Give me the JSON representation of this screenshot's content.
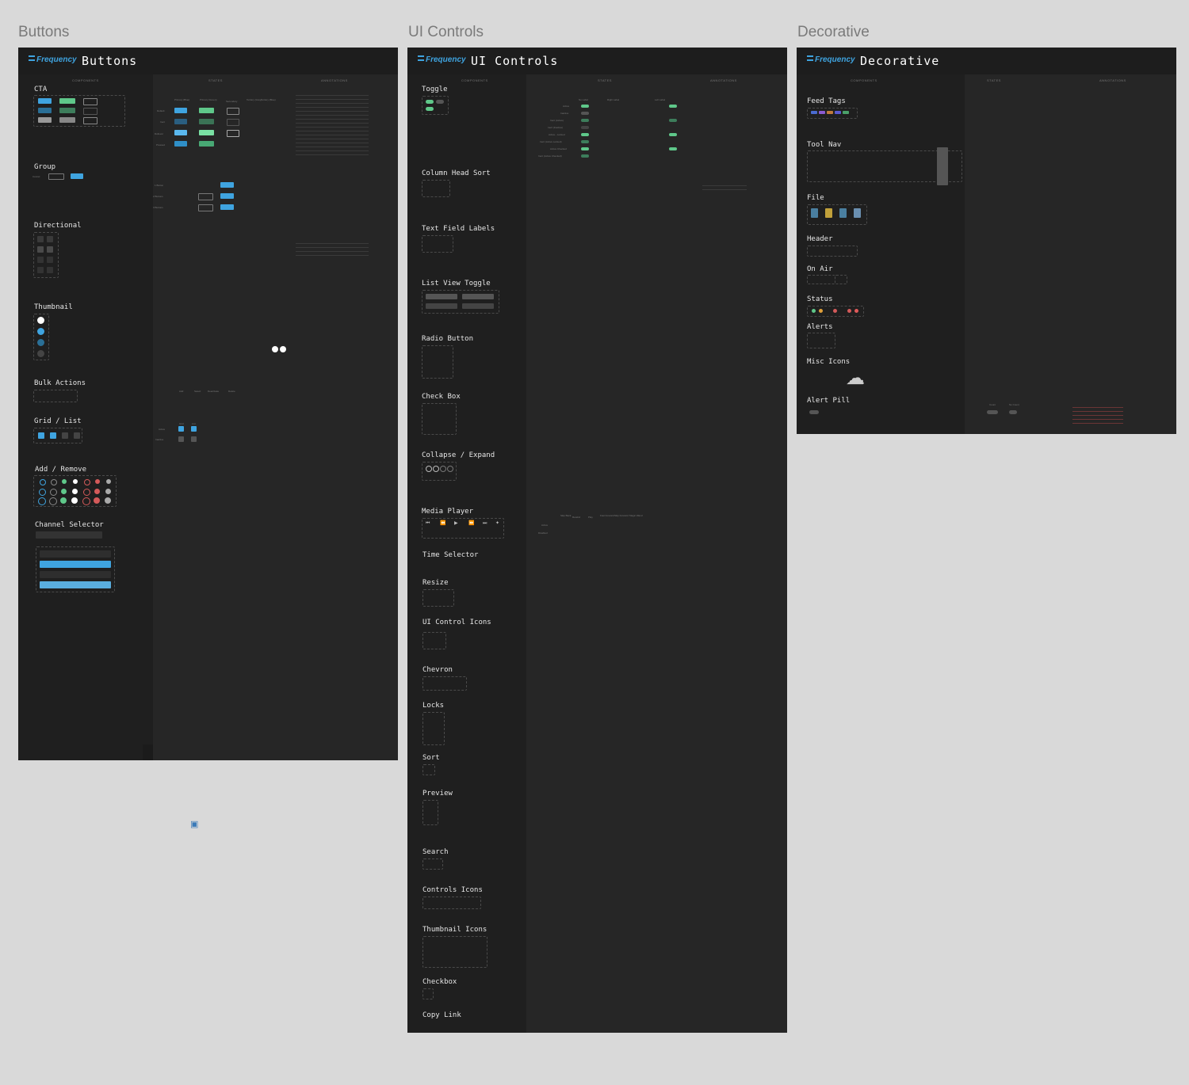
{
  "frames": [
    {
      "label": "Buttons",
      "title": "Buttons",
      "logo": "Frequency",
      "columns": [
        "COMPONENTS",
        "STATES",
        "ANNOTATIONS"
      ],
      "sections": [
        "CTA",
        "Group",
        "Directional",
        "Thumbnail",
        "Bulk Actions",
        "Grid / List",
        "Add / Remove",
        "Channel Selector"
      ],
      "states": [
        "Default",
        "Inert",
        "Rollover",
        "Pressed"
      ],
      "cta_columns": [
        "Primary (Blue)",
        "Primary (Green)",
        "Secondary",
        "Tertiary (Grey)",
        "Tertiary (Blue)"
      ],
      "group_rows": [
        "1 Button",
        "2 Buttons",
        "3 Buttons"
      ],
      "group_buttons": [
        "Cancel",
        "Discard",
        "Save"
      ],
      "bulk_columns": [
        "Add",
        "Select",
        "Deactivate",
        "Delete"
      ],
      "grid_columns": [
        "Grid",
        "List"
      ],
      "grid_states": [
        "Active",
        "Inactive"
      ]
    },
    {
      "label": "UI Controls",
      "title": "UI Controls",
      "logo": "Frequency",
      "columns": [
        "COMPONENTS",
        "STATES",
        "ANNOTATIONS"
      ],
      "sections": [
        "Toggle",
        "Column Head Sort",
        "Text Field Labels",
        "List View Toggle",
        "Radio Button",
        "Check Box",
        "Collapse / Expand",
        "Media Player",
        "Time Selector",
        "Resize",
        "UI Control Icons",
        "Chevron",
        "Locks",
        "Sort",
        "Preview",
        "Search",
        "Controls Icons",
        "Thumbnail Icons",
        "Checkbox",
        "Copy Link"
      ],
      "toggle_columns": [
        "No Label",
        "Right Label",
        "Left Label"
      ],
      "toggle_states": [
        "Active",
        "Inactive",
        "Inert (Active)",
        "Inert (Inactive)",
        "Active - Locked",
        "Inert (Active Locked)",
        "Active Checked",
        "Inert (Active Checked)"
      ],
      "media_columns": [
        "Skip Back",
        "Rewind",
        "Play",
        "Fast Forward",
        "Skip Forward",
        "Magic Wand"
      ],
      "media_states": [
        "Active",
        "Disabled"
      ]
    },
    {
      "label": "Decorative",
      "title": "Decorative",
      "logo": "Frequency",
      "columns": [
        "COMPONENTS",
        "STATES",
        "ANNOTATIONS"
      ],
      "sections": [
        "Feed Tags",
        "Tool Nav",
        "File",
        "Header",
        "On Air",
        "Status",
        "Alerts",
        "Misc Icons",
        "Alert Pill"
      ],
      "alert_pill_columns": [
        "Count",
        "No Count"
      ]
    }
  ],
  "colors": {
    "canvas": "#d9d9d9",
    "frame": "#262626",
    "accent_blue": "#3fa4e0",
    "accent_green": "#5fc88a",
    "alert_red": "#d45a5a"
  },
  "icons": [
    "upload-cloud-icon",
    "image-icon"
  ]
}
